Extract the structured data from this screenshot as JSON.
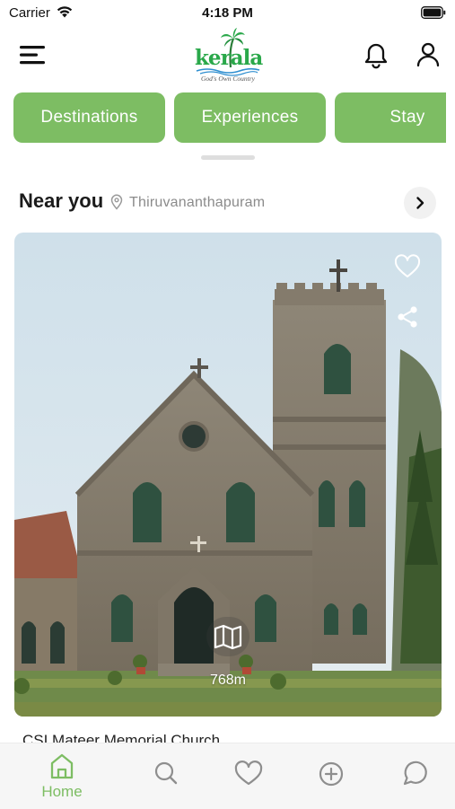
{
  "status_bar": {
    "carrier": "Carrier",
    "time": "4:18 PM"
  },
  "header": {
    "logo_text": "kerala",
    "logo_tagline": "God's Own Country"
  },
  "categories": [
    {
      "label": "Destinations"
    },
    {
      "label": "Experiences"
    },
    {
      "label": "Stay"
    }
  ],
  "near_you": {
    "title": "Near you",
    "location": "Thiruvananthapuram",
    "card": {
      "place_name": "CSI Mateer Memorial Church",
      "distance": "768m",
      "favorite": false
    }
  },
  "tab_bar": {
    "items": [
      {
        "name": "home",
        "label": "Home",
        "icon": "home-icon",
        "active": true
      },
      {
        "name": "search",
        "label": "",
        "icon": "search-icon",
        "active": false
      },
      {
        "name": "favorites",
        "label": "",
        "icon": "heart-icon",
        "active": false
      },
      {
        "name": "add",
        "label": "",
        "icon": "plus-circle-icon",
        "active": false
      },
      {
        "name": "chat",
        "label": "",
        "icon": "chat-bubble-icon",
        "active": false
      }
    ]
  },
  "colors": {
    "accent": "#7dbd63",
    "text_primary": "#1b1b1b",
    "text_secondary": "#8b8b8b",
    "icon_inactive": "#8e8e8e"
  }
}
